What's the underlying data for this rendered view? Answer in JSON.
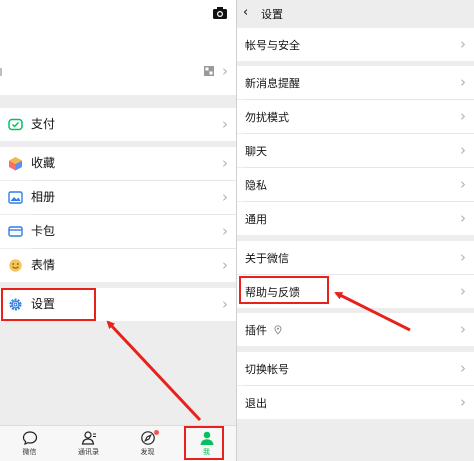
{
  "left": {
    "menu": [
      {
        "key": "pay",
        "label": "支付"
      },
      {
        "key": "favorites",
        "label": "收藏"
      },
      {
        "key": "album",
        "label": "相册"
      },
      {
        "key": "cards",
        "label": "卡包"
      },
      {
        "key": "stickers",
        "label": "表情"
      },
      {
        "key": "settings",
        "label": "设置"
      }
    ],
    "tabs": [
      {
        "key": "chats",
        "label": "微信"
      },
      {
        "key": "contacts",
        "label": "通讯录"
      },
      {
        "key": "discover",
        "label": "发现"
      },
      {
        "key": "me",
        "label": "我"
      }
    ]
  },
  "right": {
    "title": "设置",
    "items": [
      {
        "key": "account",
        "label": "帐号与安全"
      },
      {
        "key": "notifications",
        "label": "新消息提醒"
      },
      {
        "key": "dnd",
        "label": "勿扰模式"
      },
      {
        "key": "chat",
        "label": "聊天"
      },
      {
        "key": "privacy",
        "label": "隐私"
      },
      {
        "key": "general",
        "label": "通用"
      },
      {
        "key": "about",
        "label": "关于微信"
      },
      {
        "key": "help",
        "label": "帮助与反馈"
      },
      {
        "key": "plugins",
        "label": "插件"
      },
      {
        "key": "switch",
        "label": "切换帐号"
      },
      {
        "key": "logout",
        "label": "退出"
      }
    ]
  },
  "colors": {
    "accent": "#07c160",
    "annotation": "#e8211d",
    "badge": "#fa5151"
  },
  "icons": [
    "camera-icon",
    "qr-code-icon",
    "wallet-icon",
    "cube-icon",
    "photo-icon",
    "card-icon",
    "smiley-icon",
    "gear-icon",
    "chat-bubble-icon",
    "contacts-icon",
    "compass-icon",
    "person-icon",
    "pin-icon",
    "chevron-right-icon",
    "back-arrow-icon"
  ]
}
